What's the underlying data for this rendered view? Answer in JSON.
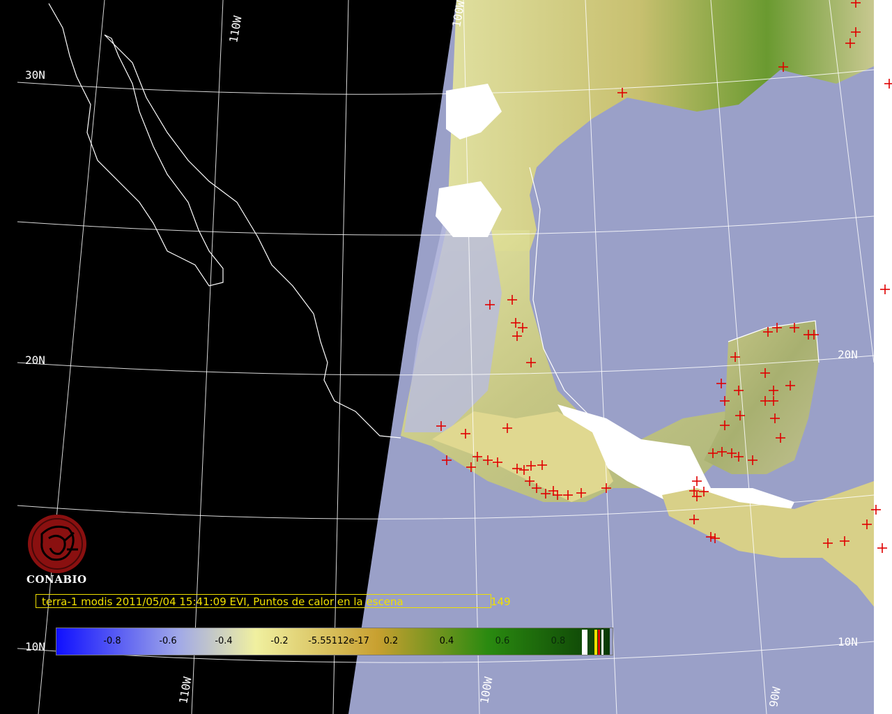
{
  "grid": {
    "lat_labels": [
      "30N",
      "20N",
      "10N",
      "20N",
      "10N"
    ],
    "lon_labels": [
      "110W",
      "100W",
      "90W",
      "110W",
      "100W",
      "90W"
    ]
  },
  "logo": {
    "name": "CONABIO"
  },
  "caption": {
    "text": "terra-1 modis 2011/05/04 15:41:09 EVI, Puntos de calor en la escena",
    "count": "149"
  },
  "colorbar": {
    "ticks": [
      "-0.8",
      "-0.6",
      "-0.4",
      "-0.2",
      "-5.55112e-17",
      "0.2",
      "0.4",
      "0.6",
      "0.8"
    ],
    "colors": {
      "low": "#1010ff",
      "mid_low": "#a0a8e8",
      "neutral": "#f0f0a0",
      "mid_high": "#c8a030",
      "high": "#2a8a10",
      "top": "#0a3a05"
    }
  },
  "colors": {
    "ocean": "#9aa0c8",
    "night": "#000000",
    "fire": "#e00000",
    "grid": "#ffffff",
    "caption": "#f0e000"
  }
}
